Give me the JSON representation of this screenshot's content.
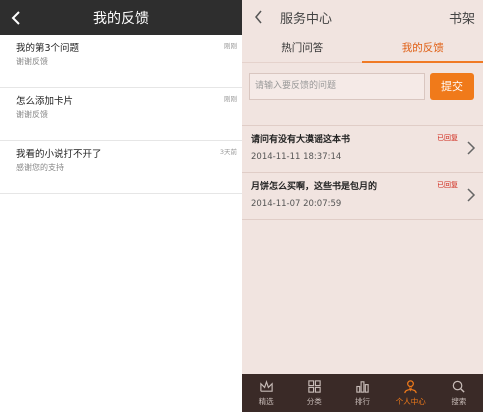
{
  "left": {
    "title": "我的反馈",
    "items": [
      {
        "question": "我的第3个问题",
        "reply": "谢谢反馈",
        "time": "刚刚"
      },
      {
        "question": "怎么添加卡片",
        "reply": "谢谢反馈",
        "time": "刚刚"
      },
      {
        "question": "我看的小说打不开了",
        "reply": "感谢您的支持",
        "time": "3天前"
      }
    ]
  },
  "right": {
    "title": "服务中心",
    "action": "书架",
    "tabs": [
      {
        "label": "热门问答"
      },
      {
        "label": "我的反馈"
      }
    ],
    "input_placeholder": "请输入要反馈的问题",
    "submit_label": "提交",
    "items": [
      {
        "question": "请问有没有大漠谣这本书",
        "date": "2014-11-11 18:37:14",
        "status": "已回复"
      },
      {
        "question": "月饼怎么买啊，这些书是包月的",
        "date": "2014-11-07 20:07:59",
        "status": "已回复"
      }
    ],
    "nav": [
      {
        "label": "精选",
        "icon": "crown-icon"
      },
      {
        "label": "分类",
        "icon": "grid-icon"
      },
      {
        "label": "排行",
        "icon": "bar-chart-icon"
      },
      {
        "label": "个人中心",
        "icon": "user-icon"
      },
      {
        "label": "搜索",
        "icon": "search-icon"
      }
    ]
  },
  "colors": {
    "accent": "#f07a1a",
    "status": "#d0271a",
    "left_header_bg": "#2e2e2e",
    "right_bg": "#f1e4e0",
    "nav_bg": "#3a2a27"
  }
}
